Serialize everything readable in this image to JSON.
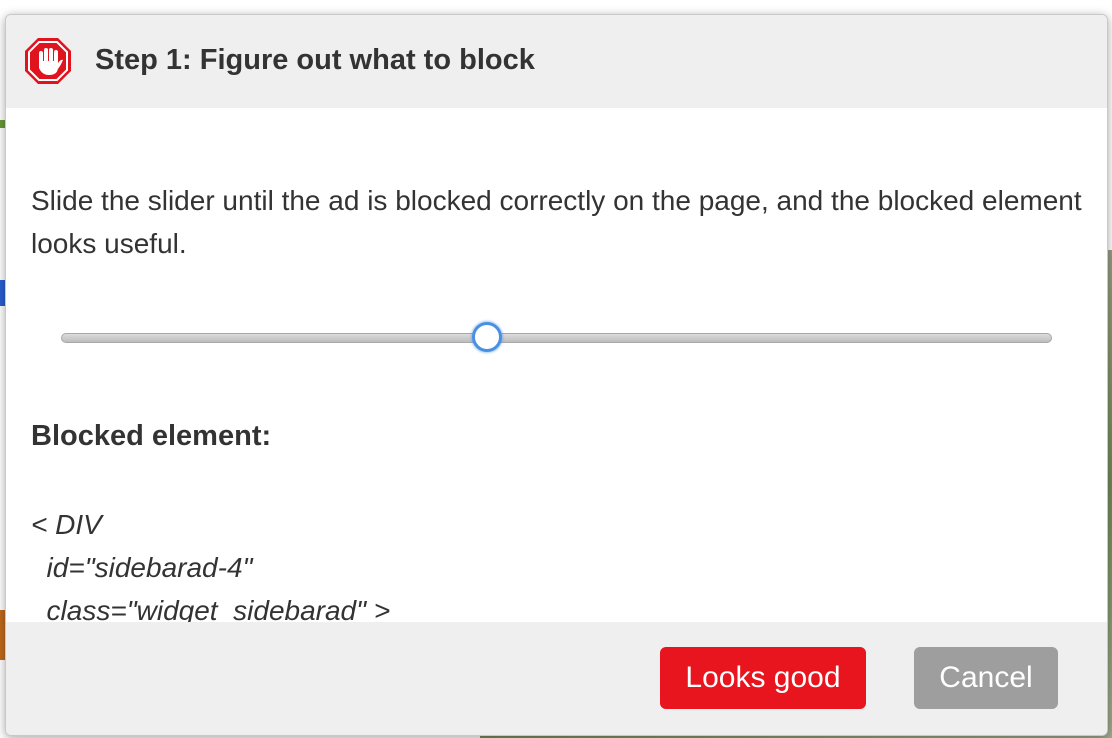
{
  "dialog": {
    "title": "Step 1: Figure out what to block",
    "instructions": "Slide the slider until the ad is blocked correctly on the page, and the blocked element looks useful.",
    "slider": {
      "value_fraction": 0.43
    },
    "blocked_heading": "Blocked element:",
    "blocked_code": {
      "line1": "< DIV",
      "line2": "  id=\"sidebarad-4\"",
      "line3": "  class=\"widget_sidebarad\" >"
    },
    "buttons": {
      "confirm_label": "Looks good",
      "cancel_label": "Cancel"
    }
  },
  "colors": {
    "primary_button": "#e8141e",
    "secondary_button": "#9e9e9e",
    "slider_focus": "#4a90e2",
    "logo_red": "#e0141e"
  },
  "icons": {
    "logo": "adblock-hand-stop-icon"
  }
}
